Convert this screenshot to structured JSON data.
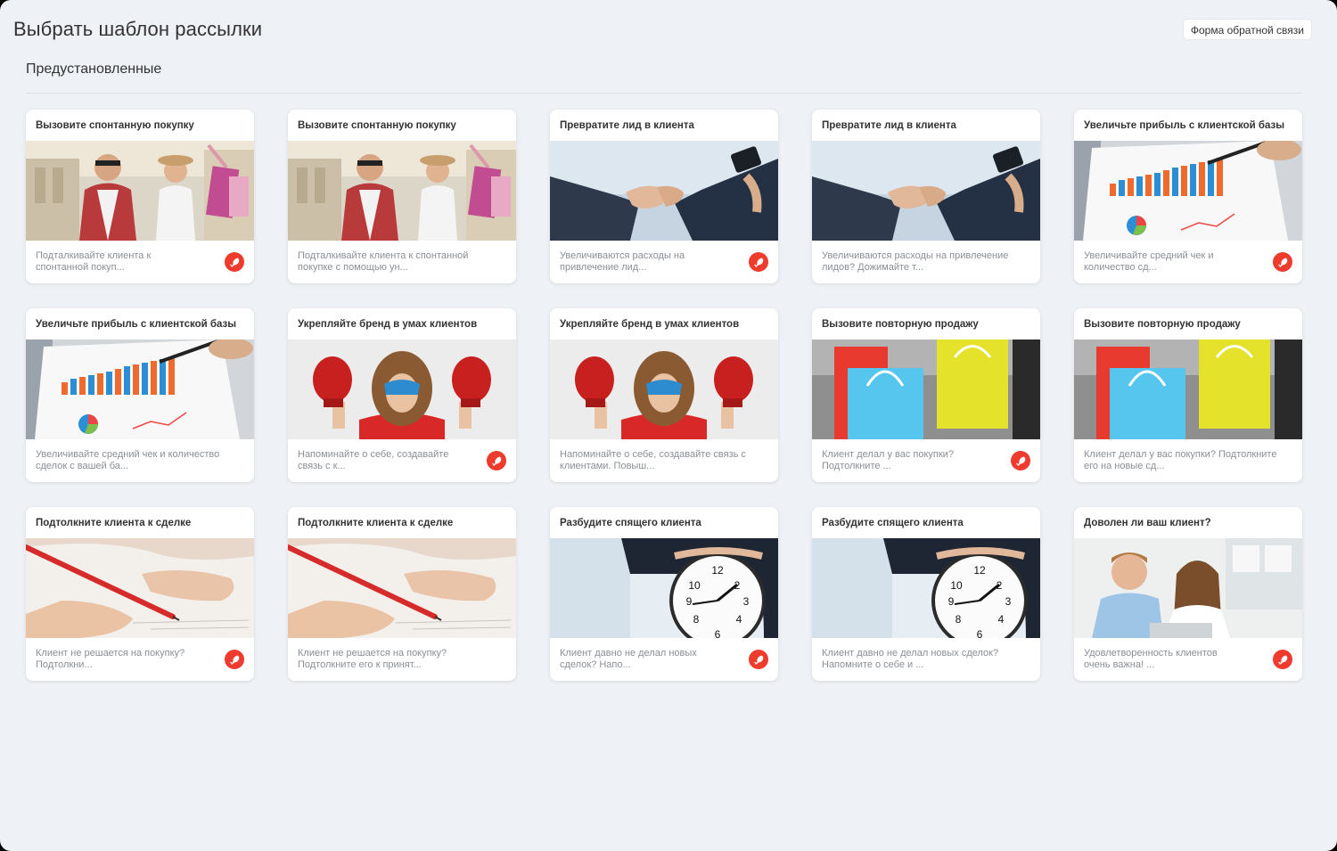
{
  "page": {
    "title": "Выбрать шаблон рассылки",
    "feedback_button": "Форма обратной связи",
    "section_title": "Предустановленные",
    "accent_color": "#ef3b2d"
  },
  "templates": [
    {
      "title": "Вызовите спонтанную покупку",
      "description": "Подталкивайте клиента к спонтанной покуп...",
      "image": "shopping-couple",
      "icon": "branded-logo-icon"
    },
    {
      "title": "Вызовите спонтанную покупку",
      "description": "Подталкивайте клиента к спонтанной покупке с помощью ун...",
      "image": "shopping-couple",
      "icon": null
    },
    {
      "title": "Превратите лид в клиента",
      "description": "Увеличиваются расходы на привлечение лид...",
      "image": "handshake",
      "icon": "branded-logo-icon"
    },
    {
      "title": "Превратите лид в клиента",
      "description": "Увеличиваются расходы на привлечение лидов? Дожимайте т...",
      "image": "handshake",
      "icon": null
    },
    {
      "title": "Увеличьте прибыль с клиентской базы",
      "description": "Увеличивайте средний чек и количество сд...",
      "image": "sales-chart",
      "icon": "branded-logo-icon"
    },
    {
      "title": "Увеличьте прибыль с клиентской базы",
      "description": "Увеличивайте средний чек и количество сделок с вашей ба...",
      "image": "sales-chart",
      "icon": null
    },
    {
      "title": "Укрепляйте бренд в умах клиентов",
      "description": "Напоминайте о себе, создавайте связь с к...",
      "image": "boxing-kid",
      "icon": "branded-logo-icon"
    },
    {
      "title": "Укрепляйте бренд в умах клиентов",
      "description": "Напоминайте о себе, создавайте связь с клиентами. Повыш...",
      "image": "boxing-kid",
      "icon": null
    },
    {
      "title": "Вызовите повторную продажу",
      "description": "Клиент делал у вас покупки? Подтолкните ...",
      "image": "shopping-bags",
      "icon": "branded-logo-icon"
    },
    {
      "title": "Вызовите повторную продажу",
      "description": "Клиент делал у вас покупки? Подтолкните его на новые сд...",
      "image": "shopping-bags",
      "icon": null
    },
    {
      "title": "Подтолкните клиента к сделке",
      "description": "Клиент не решается на покупку? Подтолкни...",
      "image": "signing-pen",
      "icon": "branded-logo-icon"
    },
    {
      "title": "Подтолкните клиента к сделке",
      "description": "Клиент не решается на покупку? Подтолкните его к принят...",
      "image": "signing-pen",
      "icon": null
    },
    {
      "title": "Разбудите спящего клиента",
      "description": "Клиент давно не делал новых сделок? Напо...",
      "image": "wall-clock",
      "icon": "branded-logo-icon"
    },
    {
      "title": "Разбудите спящего клиента",
      "description": "Клиент давно не делал новых сделок? Напомните о себе и ...",
      "image": "wall-clock",
      "icon": null
    },
    {
      "title": "Доволен ли ваш клиент?",
      "description": "Удовлетворенность клиентов очень важна! ...",
      "image": "happy-couple",
      "icon": "branded-logo-icon"
    }
  ]
}
